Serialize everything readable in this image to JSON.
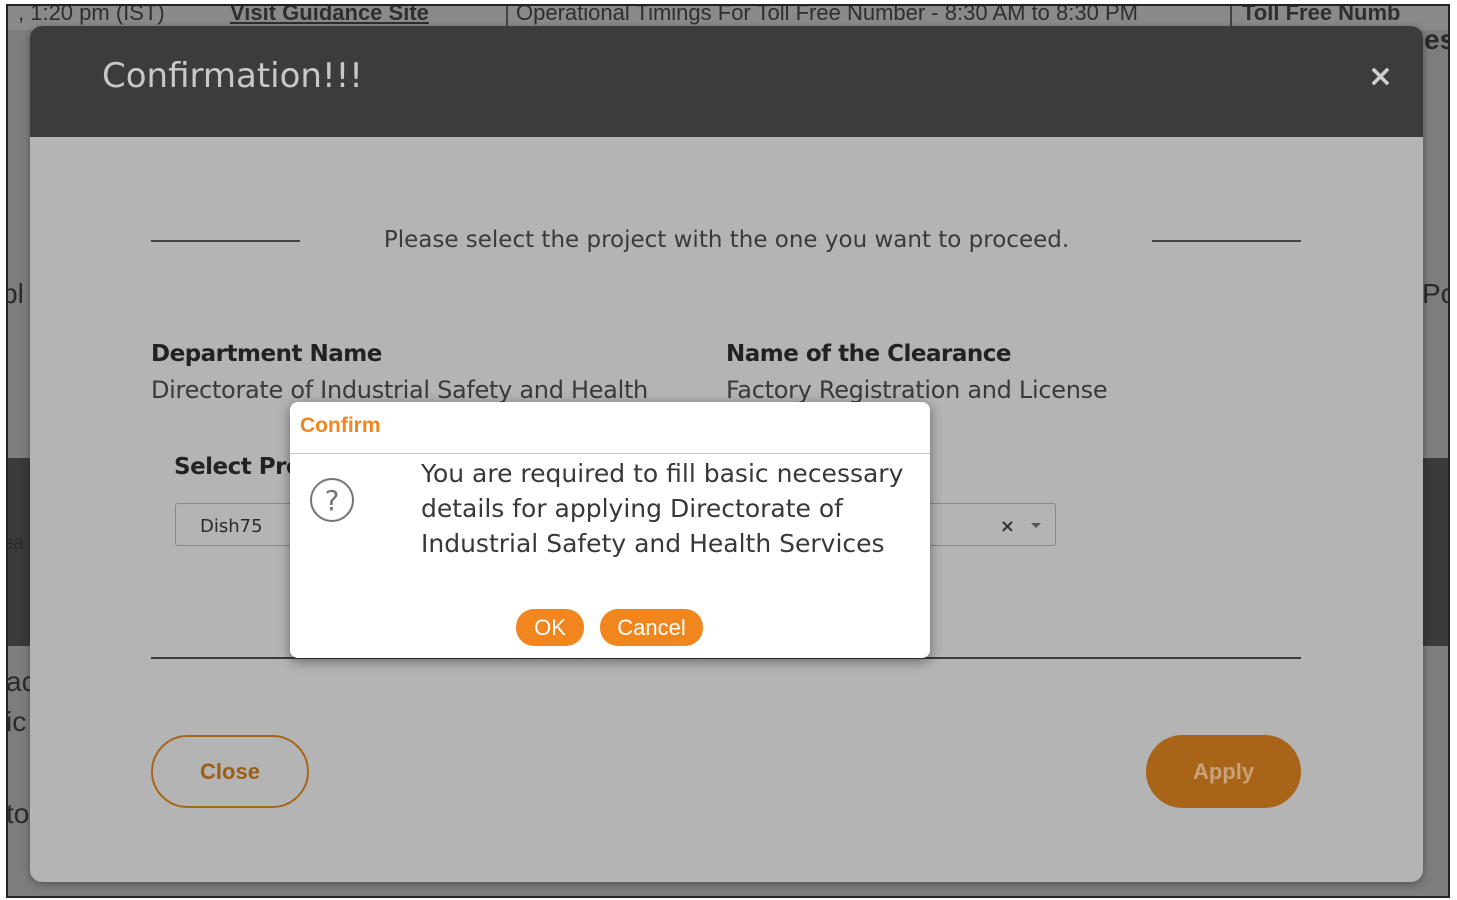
{
  "background": {
    "time_text": ", 1:20 pm (IST)",
    "guidance_link": "Visit Guidance Site",
    "timings_text": "Operational Timings For Toll Free Number - 8:30 AM to 8:30 PM",
    "tollfree_text": "Toll Free Numb",
    "fragments": [
      "bl",
      "Po",
      "ea",
      "ac",
      "ic",
      "to",
      "es"
    ]
  },
  "modal": {
    "title": "Confirmation!!!",
    "close_glyph": "×",
    "instruction": "Please select the project with the one you want to proceed.",
    "department": {
      "label": "Department Name",
      "value": "Directorate of Industrial Safety and Health"
    },
    "clearance": {
      "label": "Name of the Clearance",
      "value": "Factory Registration and License"
    },
    "select": {
      "label": "Select Project/CAF *",
      "value": "Dish75",
      "clear_glyph": "×"
    },
    "close_button": "Close",
    "apply_button": "Apply"
  },
  "confirm": {
    "title": "Confirm",
    "icon": "question-circle-icon",
    "icon_glyph": "?",
    "message": "You are required to fill basic necessary details for applying Directorate of Industrial Safety and Health Services",
    "ok_label": "OK",
    "cancel_label": "Cancel"
  },
  "colors": {
    "accent_orange": "#f0861d",
    "dimmed_orange": "#a8651a",
    "header_dark": "#3c3c3c"
  }
}
